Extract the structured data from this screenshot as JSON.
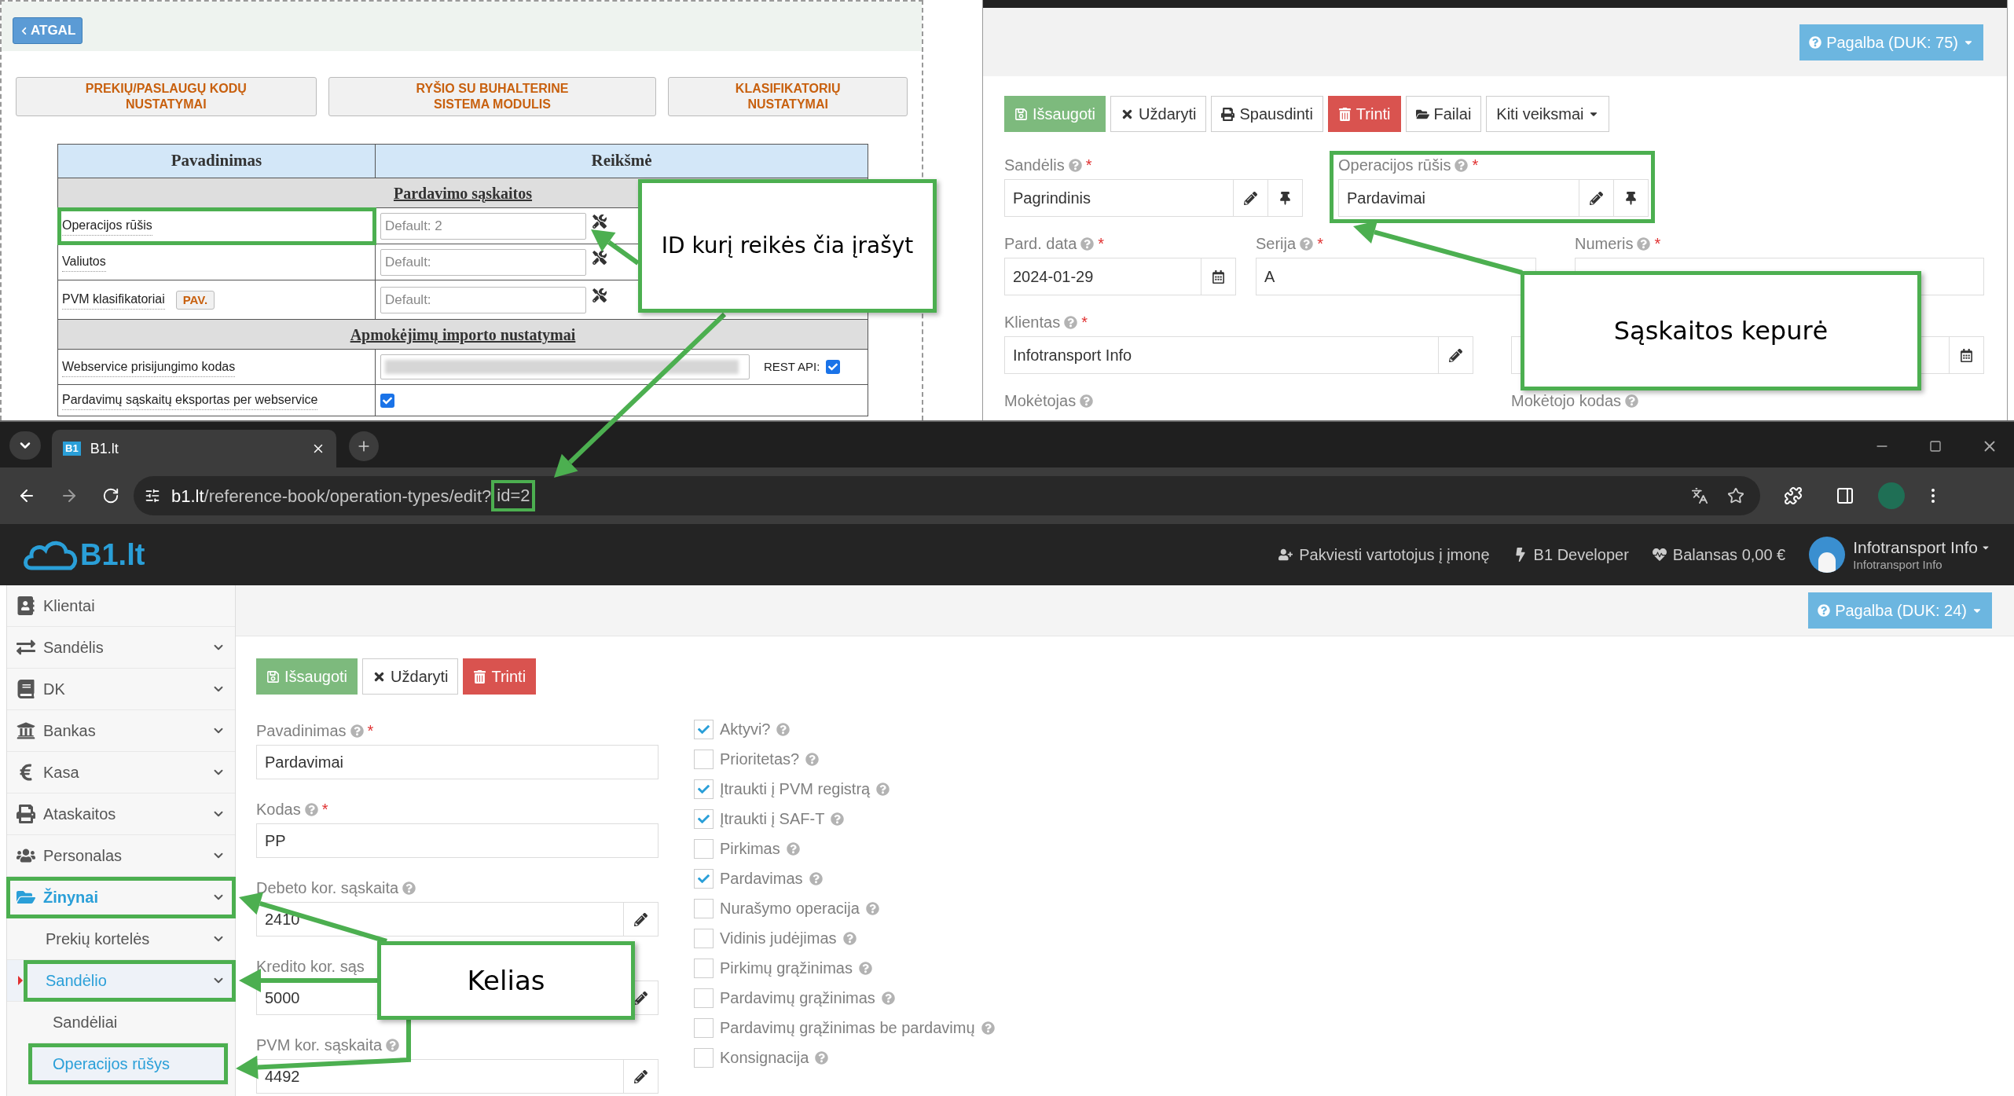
{
  "reference_panel": {
    "back_button": "ATGAL",
    "module_buttons": [
      "PREKIŲ/PASLAUGŲ KODŲ NUSTATYMAI",
      "RYŠIO SU BUHALTERINE SISTEMA MODULIS",
      "KLASIFIKATORIŲ NUSTATYMAI"
    ],
    "table": {
      "columns": [
        "Pavadinimas",
        "Reikšmė"
      ],
      "sections": [
        {
          "title": "Pardavimo sąskaitos",
          "rows": [
            {
              "kind": "input",
              "label": "Operacijos rūšis",
              "placeholder": "Default: 2"
            },
            {
              "kind": "input",
              "label": "Valiutos",
              "placeholder": "Default:"
            },
            {
              "kind": "input",
              "label": "PVM klasifikatoriai",
              "badge": "PAV.",
              "placeholder": "Default:"
            }
          ]
        },
        {
          "title": "Apmokėjimų importo nustatymai",
          "rows": [
            {
              "kind": "secret",
              "label": "Webservice prisijungimo kodas",
              "checkbox_label": "REST API:",
              "checked": true
            },
            {
              "kind": "checkbox",
              "label": "Pardavimų sąskaitų eksportas per webservice",
              "checked": true
            }
          ]
        }
      ]
    }
  },
  "invoice_panel": {
    "help_button": "Pagalba (DUK: 75)",
    "actions": [
      {
        "kind": "success",
        "label": "Išsaugoti"
      },
      {
        "kind": "default",
        "label": "Uždaryti"
      },
      {
        "kind": "default",
        "label": "Spausdinti"
      },
      {
        "kind": "danger",
        "label": "Trinti"
      },
      {
        "kind": "default",
        "label": "Failai"
      },
      {
        "kind": "dropdown",
        "label": "Kiti veiksmai"
      }
    ],
    "rows": [
      [
        {
          "label": "Sandėlis",
          "help": true,
          "mark": "*",
          "value": "Pagrindinis"
        },
        {
          "label": "Operacijos rūšis",
          "help": true,
          "mark": "*",
          "value": "Pardavimai"
        }
      ],
      [
        {
          "label": "Pard. data",
          "help": true,
          "mark": "*",
          "value": "2024-01-29"
        },
        {
          "label": "Serija",
          "help": true,
          "mark": "*",
          "value": "A"
        },
        {
          "label": "Numeris",
          "help": true,
          "mark": "*"
        }
      ],
      [
        {
          "label": "Klientas",
          "help": true,
          "mark": "*",
          "value": "Infotransport Info"
        },
        {
          "help": false
        }
      ],
      [
        {
          "label": "Mokėtojas",
          "help": true
        },
        {
          "label": "Mokėtojo kodas",
          "help": true
        }
      ]
    ]
  },
  "browser": {
    "tab": {
      "icon_text": "B1",
      "title": "B1.lt"
    },
    "url": {
      "host": "b1.lt",
      "path": "/reference-book/operation-types/edit?",
      "query": "id=2"
    }
  },
  "app": {
    "logo": "B1.lt",
    "header_links": [
      "Pakviesti vartotojus į įmonę",
      "B1 Developer",
      "Balansas 0,00 €"
    ],
    "user": {
      "name": "Infotransport Info",
      "company": "Infotransport Info"
    },
    "help_button": "Pagalba (DUK: 24)",
    "sidebar": [
      {
        "label": "Klientai",
        "chevron": false,
        "active": false
      },
      {
        "label": "Sandėlis",
        "chevron": true,
        "active": false
      },
      {
        "label": "DK",
        "chevron": true,
        "active": false
      },
      {
        "label": "Bankas",
        "chevron": true,
        "active": false
      },
      {
        "label": "Kasa",
        "chevron": true,
        "active": false
      },
      {
        "label": "Ataskaitos",
        "chevron": true,
        "active": false
      },
      {
        "label": "Personalas",
        "chevron": true,
        "active": false
      },
      {
        "label": "Žinynai",
        "chevron": true,
        "active": true,
        "children": [
          {
            "label": "Prekių kortelės",
            "chevron": true,
            "active": false
          },
          {
            "label": "Sandėlio",
            "chevron": true,
            "active": true,
            "children": [
              {
                "label": "Sandėliai",
                "chevron": false,
                "active": false
              },
              {
                "label": "Operacijos rūšys",
                "chevron": false,
                "active": true
              }
            ]
          }
        ]
      }
    ],
    "form": {
      "actions": [
        {
          "kind": "success",
          "label": "Išsaugoti"
        },
        {
          "kind": "default",
          "label": "Uždaryti"
        },
        {
          "kind": "danger",
          "label": "Trinti"
        }
      ],
      "fields": [
        {
          "label": "Pavadinimas",
          "help": true,
          "mark": "*",
          "value": "Pardavimai"
        },
        {
          "label": "Kodas",
          "help": true,
          "mark": "*",
          "value": "PP"
        },
        {
          "label": "Debeto kor. sąskaita",
          "help": true,
          "value": "2410"
        },
        {
          "label": "Kredito kor. sąs",
          "help": false,
          "value": "5000"
        },
        {
          "label": "PVM kor. sąskaita",
          "help": true,
          "value": "4492"
        }
      ],
      "checkboxes": [
        {
          "label": "Aktyvi?",
          "checked": true
        },
        {
          "label": "Prioritetas?",
          "checked": false
        },
        {
          "label": "Įtraukti į PVM registrą",
          "checked": true
        },
        {
          "label": "Įtraukti į SAF-T",
          "checked": true
        },
        {
          "label": "Pirkimas",
          "checked": false
        },
        {
          "label": "Pardavimas",
          "checked": true
        },
        {
          "label": "Nurašymo operacija",
          "checked": false
        },
        {
          "label": "Vidinis judėjimas",
          "checked": false
        },
        {
          "label": "Pirkimų grąžinimas",
          "checked": false
        },
        {
          "label": "Pardavimų grąžinimas",
          "checked": false
        },
        {
          "label": "Pardavimų grąžinimas be pardavimų",
          "checked": false
        },
        {
          "label": "Konsignacija",
          "checked": false
        }
      ]
    }
  },
  "annotations": [
    {
      "text": "ID kurį reikės čia įrašyt"
    },
    {
      "text": "Sąskaitos kepurė"
    },
    {
      "text": "Kelias"
    }
  ]
}
